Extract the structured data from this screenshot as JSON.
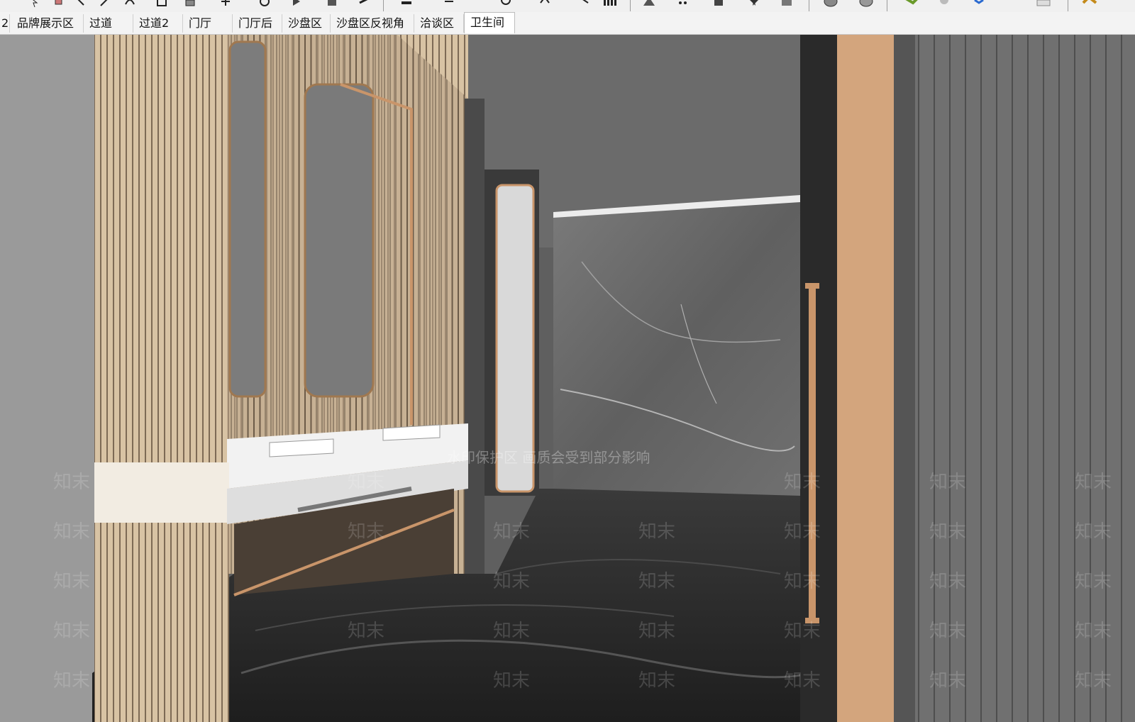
{
  "tabs": [
    {
      "label": "2",
      "active": false
    },
    {
      "label": "品牌展示区",
      "active": false
    },
    {
      "label": "过道",
      "active": false
    },
    {
      "label": "过道2",
      "active": false
    },
    {
      "label": "门厅",
      "active": false
    },
    {
      "label": "门厅后",
      "active": false
    },
    {
      "label": "沙盘区",
      "active": false
    },
    {
      "label": "沙盘区反视角",
      "active": false
    },
    {
      "label": "洽谈区",
      "active": false
    },
    {
      "label": "卫生间",
      "active": true
    }
  ],
  "toolbar_icons": [
    "select-icon",
    "eraser-icon",
    "paint-icon",
    "line-icon",
    "arc-icon",
    "rectangle-icon",
    "push-pull-icon",
    "move-icon",
    "rotate-icon",
    "scale-icon",
    "offset-icon",
    "tape-icon",
    "protractor-icon",
    "dimension-icon",
    "text-icon",
    "axes-icon",
    "orbit-icon",
    "pan-icon",
    "zoom-icon",
    "zoom-extents-icon",
    "section-icon",
    "walk-icon",
    "look-icon",
    "camera-icon",
    "components-icon",
    "styles-icon",
    "layers-icon"
  ],
  "watermark": {
    "notice": "水印保护区 画质会受到部分影响",
    "brand": "知末"
  },
  "colors": {
    "wood_panel": "#d9c2a2",
    "brass": "#c9956a",
    "marble": "#6a6a6a",
    "floor": "#2c2c2c",
    "ceiling": "#6b6b6b"
  }
}
